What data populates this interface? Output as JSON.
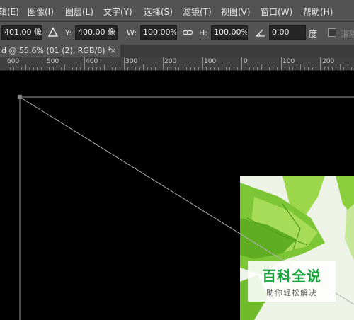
{
  "menu": {
    "items": [
      "编辑(E)",
      "图像(I)",
      "图层(L)",
      "文字(Y)",
      "选择(S)",
      "滤镜(T)",
      "视图(V)",
      "窗口(W)",
      "帮助(H)"
    ],
    "first_partial": "辑(E)"
  },
  "options": {
    "x_value": "401.00 像",
    "y_label": "Y:",
    "y_value": "400.00 像",
    "w_label": "W:",
    "w_value": "100.00%",
    "h_label": "H:",
    "h_value": "100.00%",
    "angle_value": "0.00",
    "angle_unit": "度",
    "cancel_partial": "消除"
  },
  "tab": {
    "title": "d @ 55.6% (01 (2), RGB/8) *",
    "close": "×"
  },
  "ruler": {
    "labels": [
      "600",
      "500",
      "400",
      "300",
      "200",
      "100",
      "0",
      "100",
      "200"
    ]
  },
  "watermark": {
    "main": "百科全说",
    "sub": "助你轻松解决"
  }
}
